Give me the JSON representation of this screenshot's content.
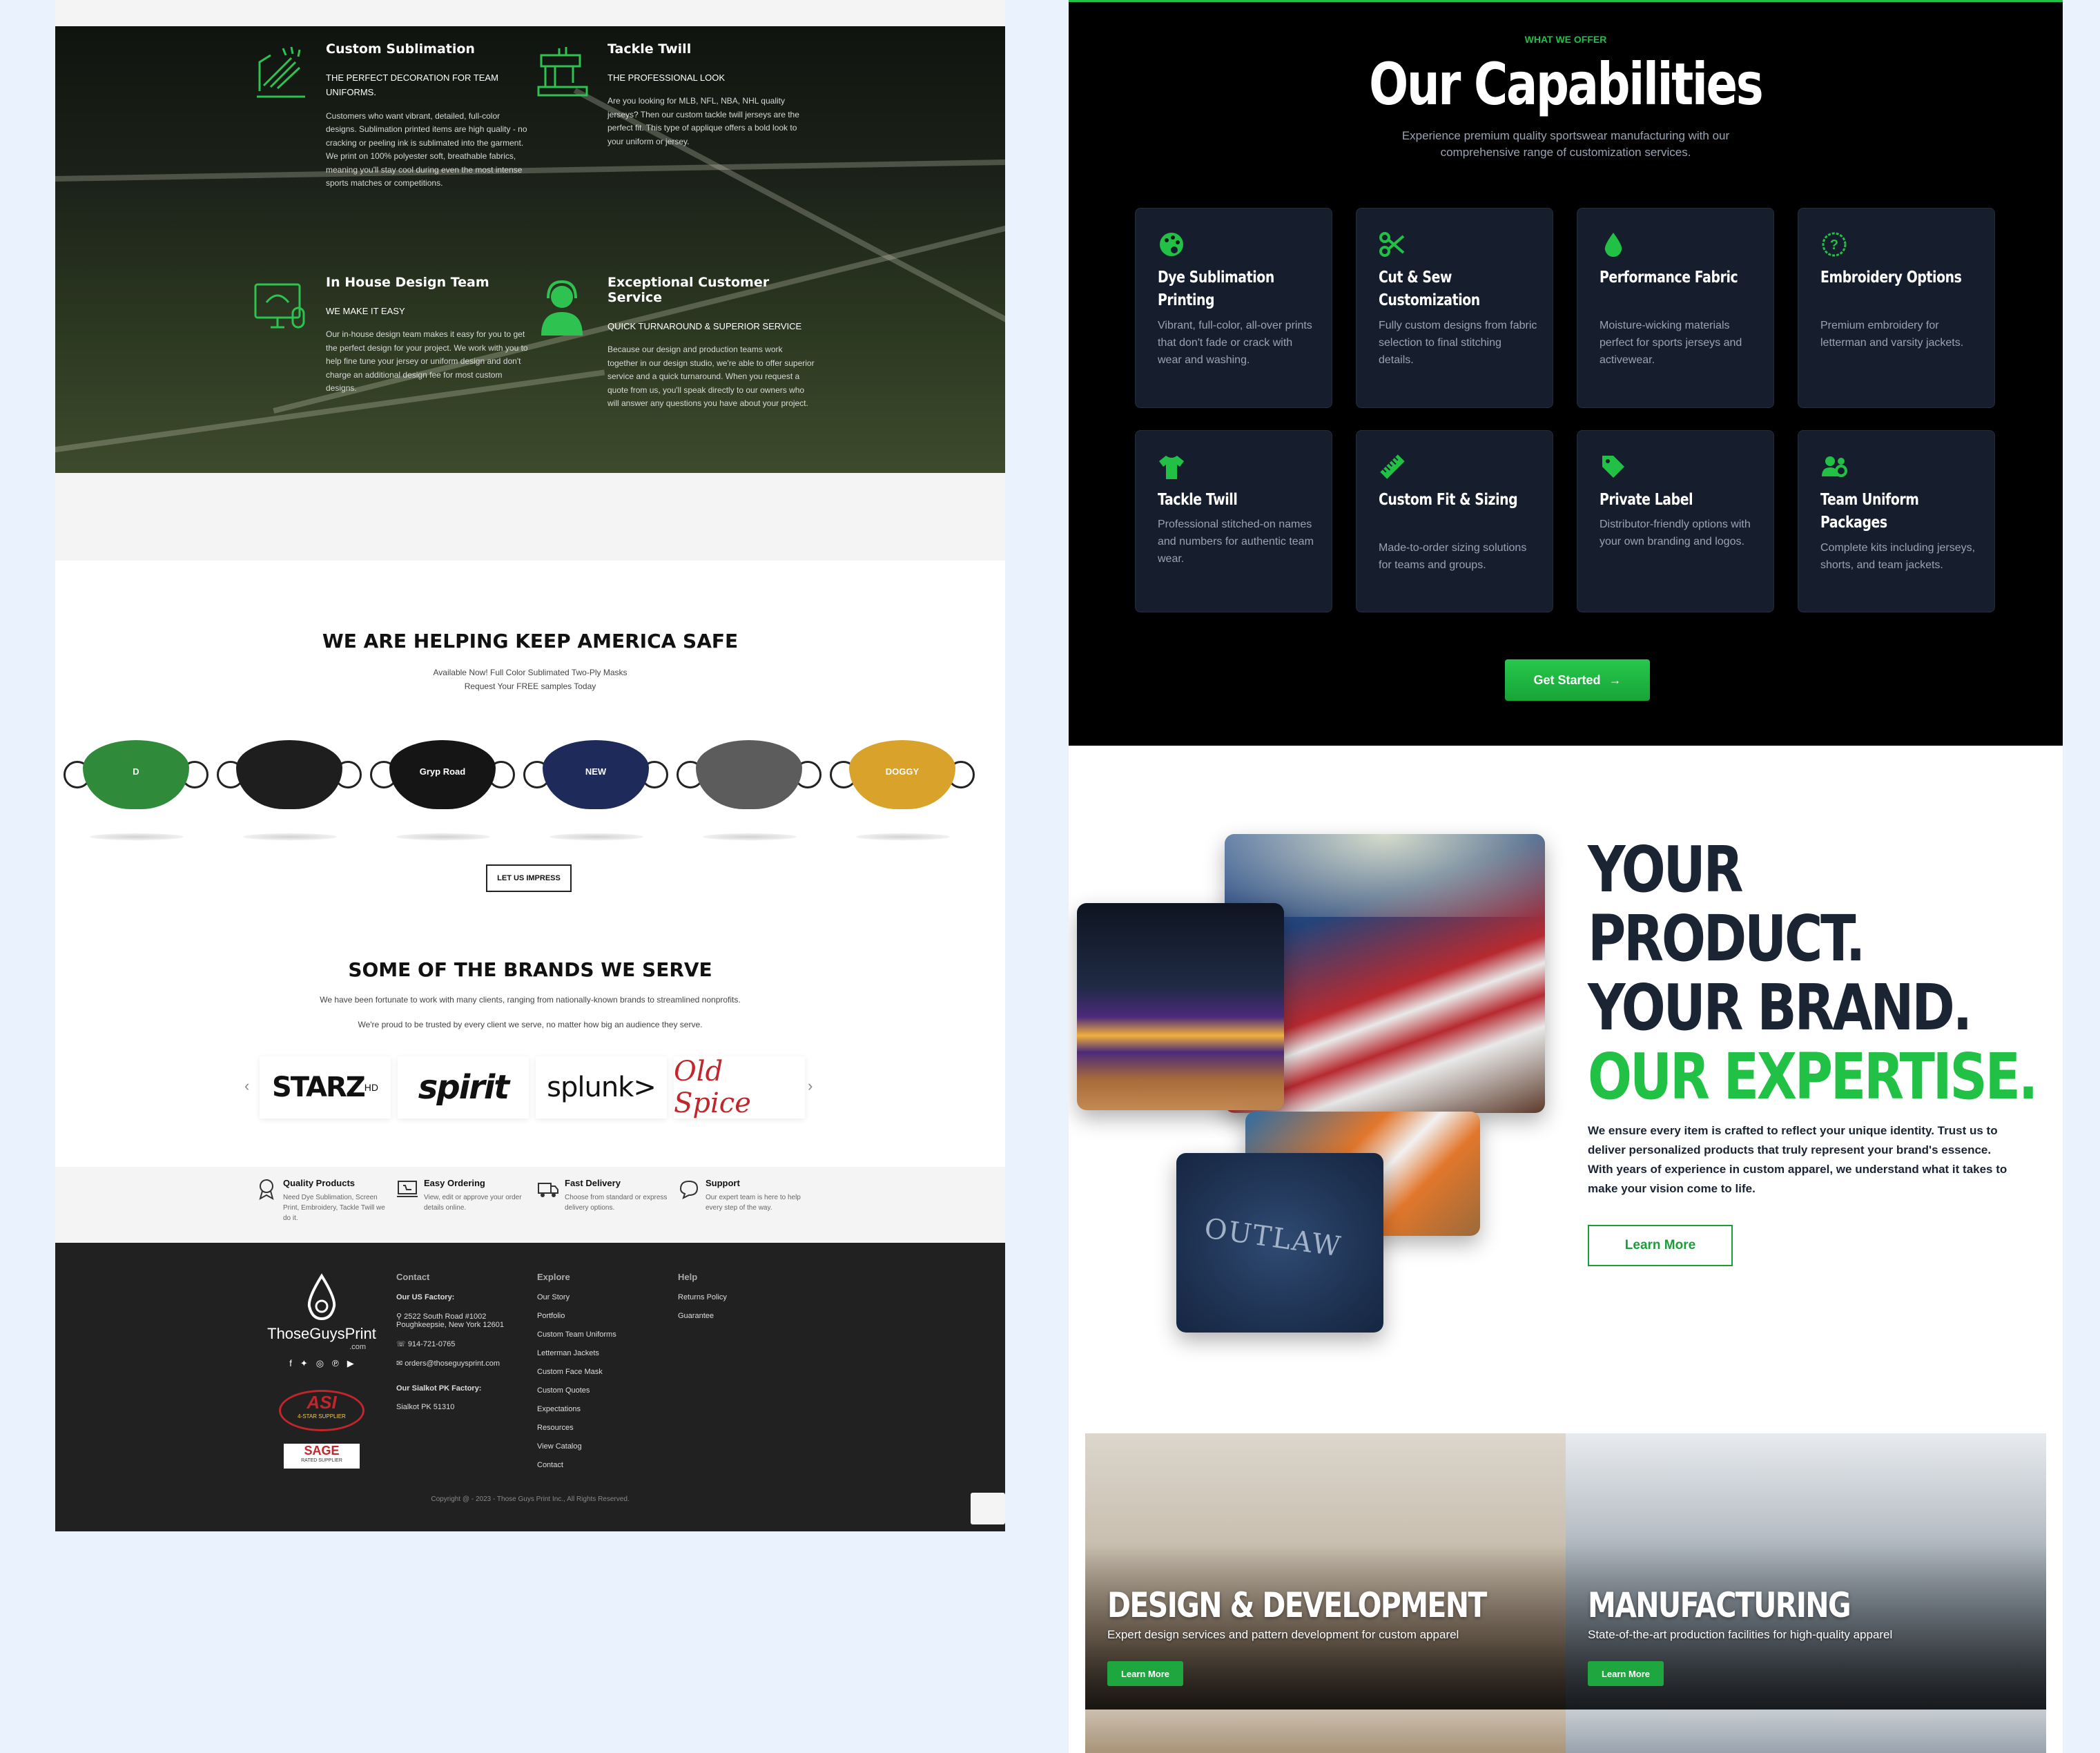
{
  "left": {
    "features": [
      {
        "title": "Custom Sublimation",
        "subtitle": "THE PERFECT DECORATION FOR TEAM UNIFORMS.",
        "body": "Customers who want vibrant, detailed, full-color designs. Sublimation printed items are high quality - no cracking or peeling ink is sublimated into the garment. We print on 100% polyester soft, breathable fabrics, meaning you'll stay cool during even the most intense sports matches or competitions.",
        "icon": "sublimation-icon"
      },
      {
        "title": "Tackle Twill",
        "subtitle": "THE PROFESSIONAL LOOK",
        "body": "Are you looking for MLB, NFL, NBA, NHL quality jerseys? Then our custom tackle twill jerseys are the perfect fit. This type of applique offers a bold look to your uniform or jersey.",
        "icon": "sewing-machine-icon"
      },
      {
        "title": "In House Design Team",
        "subtitle": "WE MAKE IT EASY",
        "body": "Our in-house design team makes it easy for you to get the perfect design for your project. We work with you to help fine tune your jersey or uniform design and don't charge an additional design fee for most custom designs.",
        "icon": "design-screen-icon"
      },
      {
        "title": "Exceptional Customer Service",
        "subtitle": "QUICK TURNAROUND & SUPERIOR SERVICE",
        "body": "Because our design and production teams work together in our design studio, we're able to offer superior service and a quick turnaround. When you request a quote from us, you'll speak directly to our owners who will answer any questions you have about your project.",
        "icon": "headset-agent-icon"
      }
    ],
    "masks": {
      "heading": "WE ARE HELPING KEEP AMERICA SAFE",
      "line1": "Available Now! Full Color Sublimated Two-Ply Masks",
      "line2": "Request Your FREE samples Today",
      "button": "LET US IMPRESS",
      "items": [
        {
          "color": "#2f8a3a",
          "label": "D"
        },
        {
          "color": "#1e1e1e",
          "label": ""
        },
        {
          "color": "#151515",
          "label": "Gryp Road"
        },
        {
          "color": "#1d2a5a",
          "label": "NEW"
        },
        {
          "color": "#5c5c5c",
          "label": ""
        },
        {
          "color": "#d9a22a",
          "label": "DOGGY"
        }
      ]
    },
    "brands": {
      "heading": "SOME OF THE BRANDS WE SERVE",
      "line1": "We have been fortunate to work with many clients, ranging from nationally-known brands to streamlined nonprofits.",
      "line2": "We're proud to be trusted by every client we serve, no matter how big an audience they serve.",
      "logos": [
        {
          "name": "STARZ",
          "sup": "HD",
          "color": "#111"
        },
        {
          "name": "spirit",
          "sup": "",
          "color": "#111"
        },
        {
          "name": "splunk>",
          "sup": "",
          "color": "#111"
        },
        {
          "name": "Old Spice",
          "sup": "",
          "color": "#c0262b"
        }
      ],
      "prev": "‹",
      "next": "›"
    },
    "perks": [
      {
        "title": "Quality Products",
        "body": "Need Dye Sublimation, Screen Print, Embroidery, Tackle Twill we do it.",
        "icon": "award-ribbon-icon"
      },
      {
        "title": "Easy Ordering",
        "body": "View, edit or approve your order details online.",
        "icon": "laptop-cart-icon"
      },
      {
        "title": "Fast Delivery",
        "body": "Choose from standard or express delivery options.",
        "icon": "truck-icon"
      },
      {
        "title": "Support",
        "body": "Our expert team is here to help every step of the way.",
        "icon": "chat-bubble-icon"
      }
    ],
    "footer": {
      "logo_text": "ThoseGuysPrint",
      "logo_sub": ".com",
      "asi": "ASI",
      "asi_sub": "4-STAR SUPPLIER",
      "sage": "SAGE",
      "sage_sub": "RATED SUPPLIER",
      "contact_title": "Contact",
      "us_factory_label": "Our US Factory:",
      "us_address": "2522 South Road #1002 Poughkeepsie, New York 12601",
      "phone": "914-721-0765",
      "email": "orders@thoseguysprint.com",
      "pk_factory_label": "Our Sialkot PK Factory:",
      "pk_address": "Sialkot PK 51310",
      "explore_title": "Explore",
      "explore_links": [
        "Our Story",
        "Portfolio",
        "Custom Team Uniforms",
        "Letterman Jackets",
        "Custom Face Mask",
        "Custom Quotes",
        "Expectations",
        "Resources",
        "View Catalog",
        "Contact"
      ],
      "help_title": "Help",
      "help_links": [
        "Returns Policy",
        "Guarantee"
      ],
      "copyright": "Copyright @ - 2023 - Those Guys Print Inc., All Rights Reserved."
    }
  },
  "right": {
    "eyebrow": "WHAT WE OFFER",
    "title": "Our Capabilities",
    "intro1": "Experience premium quality sportswear manufacturing with our",
    "intro2": "comprehensive range of customization services.",
    "cards": [
      {
        "title": "Dye Sublimation Printing",
        "desc": "Vibrant, full-color, all-over prints that don't fade or crack with wear and washing.",
        "icon": "palette-icon"
      },
      {
        "title": "Cut & Sew Customization",
        "desc": "Fully custom designs from fabric selection to final stitching details.",
        "icon": "scissors-icon"
      },
      {
        "title": "Performance Fabric",
        "desc": "Moisture-wicking materials perfect for sports jerseys and activewear.",
        "icon": "droplet-icon"
      },
      {
        "title": "Embroidery Options",
        "desc": "Premium embroidery for letterman and varsity jackets.",
        "icon": "question-circle-icon"
      },
      {
        "title": "Tackle Twill",
        "desc": "Professional stitched-on names and numbers for authentic team wear.",
        "icon": "tshirt-icon"
      },
      {
        "title": "Custom Fit & Sizing",
        "desc": "Made-to-order sizing solutions for teams and groups.",
        "icon": "ruler-icon"
      },
      {
        "title": "Private Label",
        "desc": "Distributor-friendly options with your own branding and logos.",
        "icon": "tag-icon"
      },
      {
        "title": "Team Uniform Packages",
        "desc": "Complete kits including jerseys, shorts, and team jackets.",
        "icon": "users-gear-icon"
      }
    ],
    "cta": "Get Started",
    "cta_arrow": "→",
    "hero": {
      "line1": "YOUR",
      "line2": "PRODUCT.",
      "line3": "YOUR BRAND.",
      "line4": "OUR EXPERTISE.",
      "body": "We ensure every item is crafted to reflect your unique identity. Trust us to deliver personalized products that truly represent your brand's essence. With years of experience in custom apparel, we understand what it takes to make your vision come to life.",
      "button": "Learn More",
      "jersey_text": "OUTLAW"
    },
    "tiles": [
      {
        "title": "DESIGN & DEVELOPMENT",
        "desc": "Expert design services and pattern development for custom apparel",
        "button": "Learn More"
      },
      {
        "title": "MANUFACTURING",
        "desc": "State-of-the-art production facilities for high-quality apparel",
        "button": "Learn More"
      }
    ]
  },
  "colors": {
    "accent_green": "#21c145",
    "dark_navy": "#1b2433",
    "card_bg": "#161d2c"
  }
}
